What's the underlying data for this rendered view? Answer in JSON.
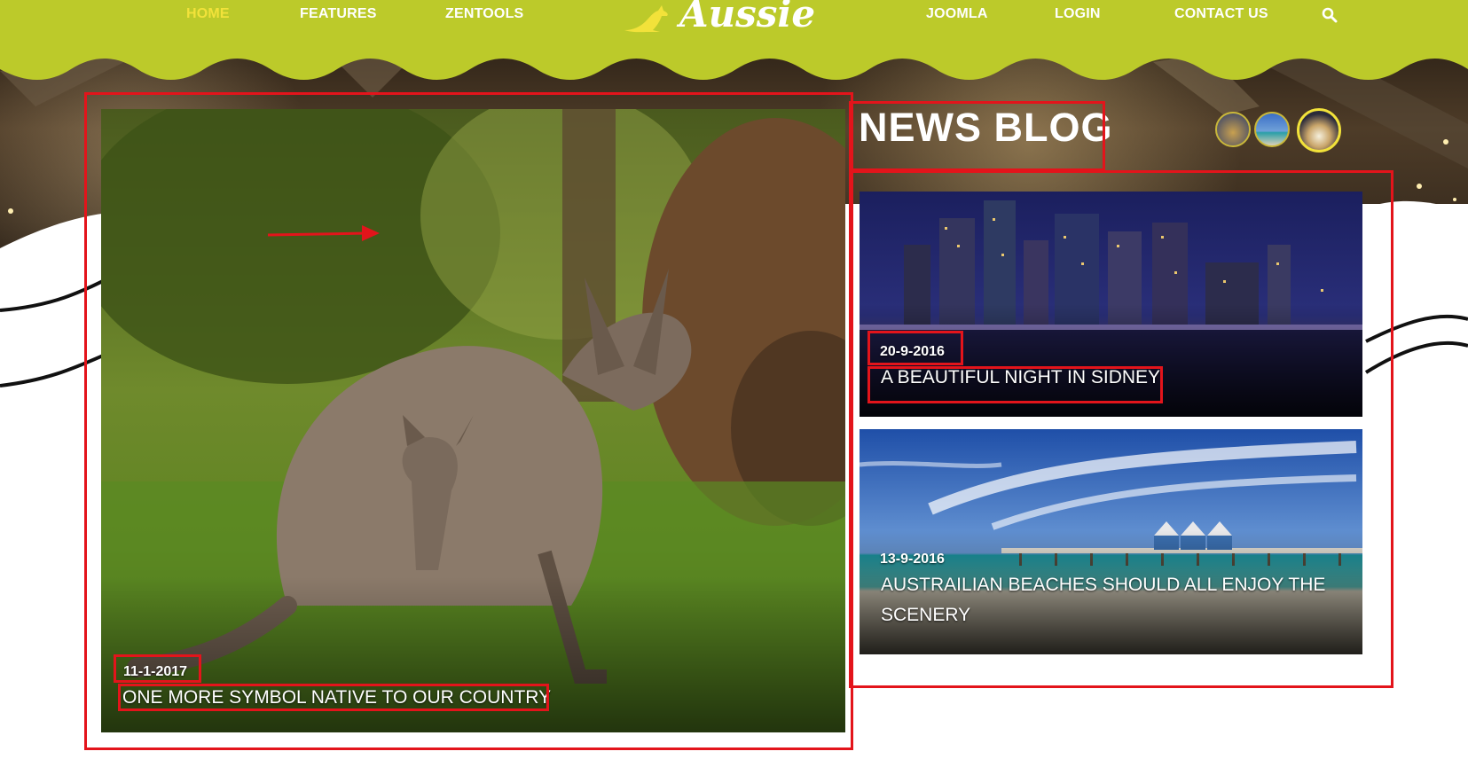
{
  "nav": {
    "left_items": [
      "HOME",
      "FEATURES",
      "ZENTOOLS"
    ],
    "right_items": [
      "JOOMLA",
      "LOGIN",
      "CONTACT US"
    ],
    "active": "HOME",
    "search_icon": "search-icon"
  },
  "logo": {
    "text": "Aussie",
    "icon": "kangaroo-icon"
  },
  "featured": {
    "date": "11-1-2017",
    "title": "ONE MORE SYMBOL NATIVE TO OUR COUNTRY"
  },
  "blog": {
    "heading": "NEWS BLOG",
    "posts": [
      {
        "date": "20-9-2016",
        "title": "A BEAUTIFUL NIGHT IN SIDNEY"
      },
      {
        "date": "13-9-2016",
        "title_line1": "AUSTRAILIAN BEACHES SHOULD ALL ENJOY THE",
        "title_line2": "SCENERY"
      }
    ]
  },
  "colors": {
    "header": "#bcca2a",
    "active_nav": "#f2e23a",
    "annotation": "#e3141b"
  }
}
